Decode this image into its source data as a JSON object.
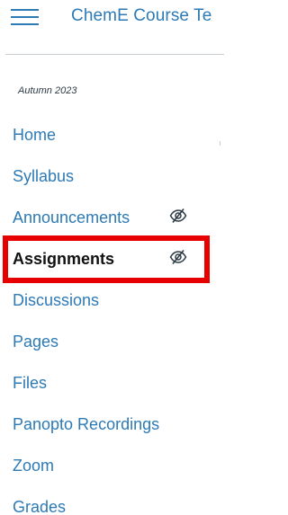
{
  "header": {
    "course_title": "ChemE Course Te",
    "menu_icon": "hamburger-icon"
  },
  "term": "Autumn 2023",
  "nav": {
    "items": [
      {
        "label": "Home",
        "active": false,
        "hidden_icon": false
      },
      {
        "label": "Syllabus",
        "active": false,
        "hidden_icon": false
      },
      {
        "label": "Announcements",
        "active": false,
        "hidden_icon": true
      },
      {
        "label": "Assignments",
        "active": true,
        "hidden_icon": true
      },
      {
        "label": "Discussions",
        "active": false,
        "hidden_icon": false
      },
      {
        "label": "Pages",
        "active": false,
        "hidden_icon": false
      },
      {
        "label": "Files",
        "active": false,
        "hidden_icon": false
      },
      {
        "label": "Panopto Recordings",
        "active": false,
        "hidden_icon": false
      },
      {
        "label": "Zoom",
        "active": false,
        "hidden_icon": false
      },
      {
        "label": "Grades",
        "active": false,
        "hidden_icon": false
      }
    ]
  },
  "colors": {
    "link": "#2d7ab5",
    "active_text": "#111111",
    "highlight": "#e60000",
    "divider": "#c7cdd1",
    "icon": "#2d3b45"
  },
  "icons": {
    "visibility_hidden": "eye-slash-icon"
  }
}
